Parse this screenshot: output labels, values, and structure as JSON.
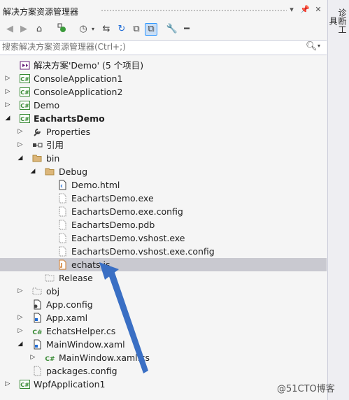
{
  "panel": {
    "title": "解决方案资源管理器",
    "title_buttons": [
      "chevron-down-icon",
      "pin-icon",
      "close-icon"
    ]
  },
  "toolbar": {
    "tools": [
      "back-icon",
      "forward-icon",
      "home-icon",
      "pending-changes-icon",
      "history-icon",
      "sync-icon",
      "refresh-icon",
      "collapse-all-icon",
      "show-all-files-icon",
      "properties-icon",
      "preview-icon"
    ]
  },
  "search": {
    "placeholder": "搜索解决方案资源管理器(Ctrl+;)"
  },
  "tree": [
    {
      "label": "解决方案'Demo' (5 个项目)",
      "icon": "solution-icon",
      "bold": false
    },
    {
      "label": "ConsoleApplication1",
      "icon": "csharp-project-icon",
      "expander": "collapsed"
    },
    {
      "label": "ConsoleApplication2",
      "icon": "csharp-project-icon",
      "expander": "collapsed"
    },
    {
      "label": "Demo",
      "icon": "csharp-project-icon",
      "expander": "collapsed"
    },
    {
      "label": "EachartsDemo",
      "icon": "csharp-project-icon",
      "expander": "expanded",
      "bold": true
    },
    {
      "label": "Properties",
      "icon": "wrench-icon",
      "expander": "collapsed"
    },
    {
      "label": "引用",
      "icon": "references-icon",
      "expander": "collapsed"
    },
    {
      "label": "bin",
      "icon": "folder-open-icon",
      "expander": "expanded"
    },
    {
      "label": "Debug",
      "icon": "folder-open-icon",
      "expander": "expanded"
    },
    {
      "label": "Demo.html",
      "icon": "html-file-icon"
    },
    {
      "label": "EachartsDemo.exe",
      "icon": "file-icon"
    },
    {
      "label": "EachartsDemo.exe.config",
      "icon": "file-icon"
    },
    {
      "label": "EachartsDemo.pdb",
      "icon": "file-icon"
    },
    {
      "label": "EachartsDemo.vshost.exe",
      "icon": "file-icon"
    },
    {
      "label": "EachartsDemo.vshost.exe.config",
      "icon": "file-icon"
    },
    {
      "label": "echats.js",
      "icon": "js-file-icon",
      "selected": true
    },
    {
      "label": "Release",
      "icon": "folder-dotted-icon"
    },
    {
      "label": "obj",
      "icon": "folder-dotted-icon",
      "expander": "collapsed"
    },
    {
      "label": "App.config",
      "icon": "config-file-icon"
    },
    {
      "label": "App.xaml",
      "icon": "xaml-file-icon",
      "expander": "collapsed"
    },
    {
      "label": "EchatsHelper.cs",
      "icon": "csharp-file-icon",
      "expander": "collapsed"
    },
    {
      "label": "MainWindow.xaml",
      "icon": "xaml-file-icon",
      "expander": "expanded"
    },
    {
      "label": "MainWindow.xaml.cs",
      "icon": "csharp-file-icon",
      "expander": "collapsed"
    },
    {
      "label": "packages.config",
      "icon": "file-dotted-icon"
    },
    {
      "label": "WpfApplication1",
      "icon": "csharp-project-icon",
      "expander": "collapsed"
    }
  ],
  "side_tabs": [
    "诊断工具"
  ],
  "watermark": "@51CTO博客",
  "colors": {
    "selection": "#c9c9d0",
    "arrow": "#3a6fc4",
    "csharp_green": "#388a34"
  }
}
